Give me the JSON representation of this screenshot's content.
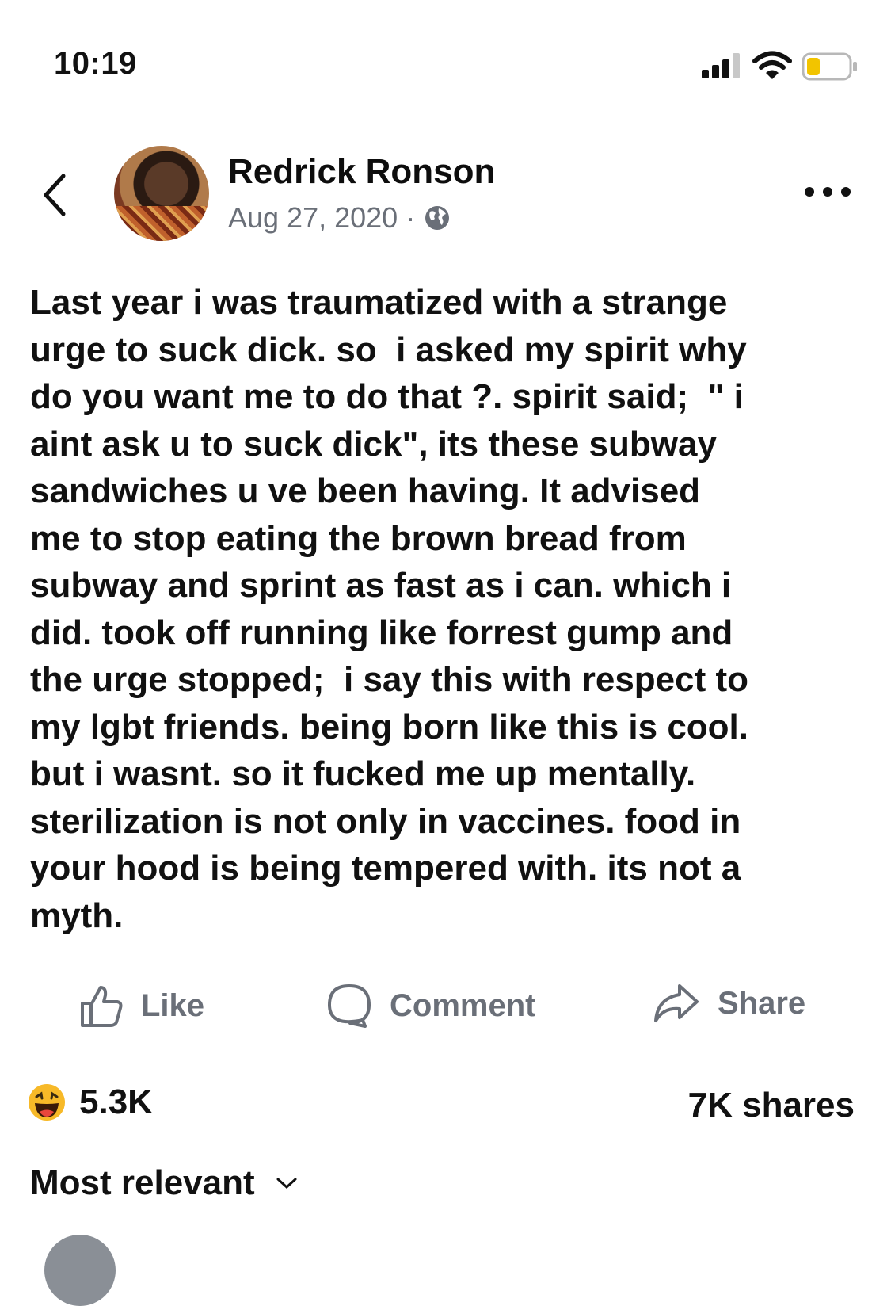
{
  "status_bar": {
    "time": "10:19",
    "icons": [
      "cellular-signal-icon",
      "wifi-icon",
      "battery-low-icon"
    ],
    "battery_color": "#f2c400"
  },
  "post": {
    "author": "Redrick Ronson",
    "date": "Aug 27, 2020",
    "separator": "·",
    "privacy_icon": "globe-icon",
    "text": "Last year i was traumatized with a strange\nurge to suck dick. so  i asked my spirit why\ndo you want me to do that ?. spirit said;  \" i\naint ask u to suck dick\", its these subway\nsandwiches u ve been having. It advised\nme to stop eating the brown bread from\nsubway and sprint as fast as i can. which i\ndid. took off running like forrest gump and\nthe urge stopped;  i say this with respect to\nmy lgbt friends. being born like this is cool.\nbut i wasnt. so it fucked me up mentally.\nsterilization is not only in vaccines. food in\nyour hood is being tempered with. its not a\nmyth."
  },
  "actions": {
    "like": "Like",
    "comment": "Comment",
    "share": "Share"
  },
  "stats": {
    "reaction_icon": "haha-emoji-icon",
    "reaction_count": "5.3K",
    "shares": "7K shares"
  },
  "comments": {
    "sort_label": "Most relevant"
  },
  "colors": {
    "text": "#111111",
    "muted": "#6a6f78",
    "background": "#ffffff",
    "emoji_face": "#f7b928"
  }
}
